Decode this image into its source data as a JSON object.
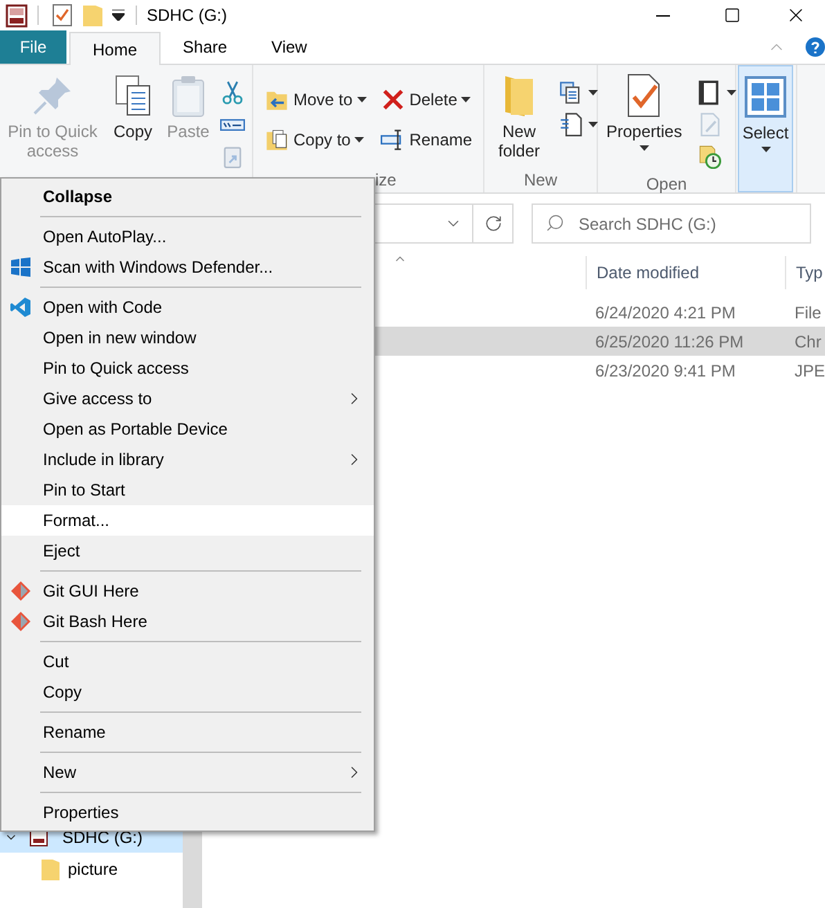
{
  "window": {
    "title": "SDHC (G:)"
  },
  "ribbon": {
    "tabs": [
      {
        "label": "File",
        "kind": "file",
        "selected": false
      },
      {
        "label": "Home",
        "kind": "tab",
        "selected": true
      },
      {
        "label": "Share",
        "kind": "tab",
        "selected": false
      },
      {
        "label": "View",
        "kind": "tab",
        "selected": false
      }
    ],
    "groups": [
      {
        "columns": [
          [
            {
              "kind": "pin",
              "label": "Pin to Quick access",
              "disabled": true,
              "dropdown": false
            }
          ],
          [
            {
              "kind": "copy",
              "label": "Copy",
              "disabled": false,
              "dropdown": false
            }
          ],
          [
            {
              "kind": "paste",
              "label": "Paste",
              "disabled": true,
              "dropdown": false
            }
          ],
          [
            {
              "kind": "cut",
              "disabled": false,
              "dropdown": false
            },
            {
              "kind": "copypath",
              "disabled": false,
              "dropdown": false
            },
            {
              "kind": "shortcut",
              "disabled": true,
              "dropdown": false
            }
          ]
        ]
      },
      {
        "label": "ize",
        "columns": [
          [
            {
              "kind": "move",
              "label": "Move to",
              "disabled": false,
              "dropdown": true
            },
            {
              "kind": "copyto",
              "label": "Copy to",
              "disabled": false,
              "dropdown": true
            }
          ],
          [
            {
              "kind": "delete",
              "label": "Delete",
              "disabled": false,
              "dropdown": true
            },
            {
              "kind": "rename",
              "label": "Rename",
              "disabled": false,
              "dropdown": false
            }
          ]
        ]
      },
      {
        "label": "New",
        "columns": [
          [
            {
              "kind": "newfolder",
              "label": "New folder",
              "disabled": false,
              "dropdown": false
            }
          ],
          [
            {
              "kind": "newitem",
              "disabled": false,
              "dropdown": true
            },
            {
              "kind": "easyaccess",
              "disabled": false,
              "dropdown": true
            }
          ]
        ]
      },
      {
        "label": "Open",
        "columns": [
          [
            {
              "kind": "properties",
              "label": "Properties",
              "disabled": false,
              "dropdown": true
            }
          ],
          [
            {
              "kind": "open",
              "disabled": false,
              "dropdown": true
            },
            {
              "kind": "edit",
              "disabled": true,
              "dropdown": false
            },
            {
              "kind": "history",
              "disabled": false,
              "dropdown": false
            }
          ]
        ]
      },
      {
        "columns": [
          [
            {
              "kind": "select",
              "label": "Select",
              "disabled": false,
              "dropdown": true
            }
          ]
        ]
      }
    ]
  },
  "search": {
    "placeholder": "Search SDHC (G:)"
  },
  "file_list": {
    "columns": [
      {
        "sorted": true
      },
      {
        "label": "Date modified",
        "sorted": false
      },
      {
        "label": "Typ",
        "sorted": false
      }
    ],
    "rows": [
      {
        "date_modified": "6/24/2020 4:21 PM",
        "type": "File",
        "selected": false
      },
      {
        "date_modified": "6/25/2020 11:26 PM",
        "type": "Chr",
        "selected": true
      },
      {
        "date_modified": "6/23/2020 9:41 PM",
        "type": "JPE",
        "selected": false
      }
    ]
  },
  "navigation_pane": {
    "items": [
      {
        "label": "SDHC (G:)",
        "selected": true,
        "expanded": true,
        "children": [
          {
            "label": "picture",
            "selected": false
          }
        ]
      }
    ]
  },
  "context_menu": {
    "items": [
      {
        "kind": "plain",
        "label": "Collapse",
        "default": true,
        "submenu": false,
        "selected": false
      },
      {
        "kind": "separator"
      },
      {
        "kind": "plain",
        "label": "Open AutoPlay...",
        "default": false,
        "submenu": false,
        "selected": false
      },
      {
        "kind": "shield",
        "label": "Scan with Windows Defender...",
        "default": false,
        "submenu": false,
        "selected": false
      },
      {
        "kind": "separator"
      },
      {
        "kind": "code",
        "label": "Open with Code",
        "default": false,
        "submenu": false,
        "selected": false
      },
      {
        "kind": "plain",
        "label": "Open in new window",
        "default": false,
        "submenu": false,
        "selected": false
      },
      {
        "kind": "plain",
        "label": "Pin to Quick access",
        "default": false,
        "submenu": false,
        "selected": false
      },
      {
        "kind": "plain",
        "label": "Give access to",
        "default": false,
        "submenu": true,
        "selected": false
      },
      {
        "kind": "plain",
        "label": "Open as Portable Device",
        "default": false,
        "submenu": false,
        "selected": false
      },
      {
        "kind": "plain",
        "label": "Include in library",
        "default": false,
        "submenu": true,
        "selected": false
      },
      {
        "kind": "plain",
        "label": "Pin to Start",
        "default": false,
        "submenu": false,
        "selected": false
      },
      {
        "kind": "plain",
        "label": "Format...",
        "default": false,
        "submenu": false,
        "selected": true
      },
      {
        "kind": "plain",
        "label": "Eject",
        "default": false,
        "submenu": false,
        "selected": false
      },
      {
        "kind": "separator"
      },
      {
        "kind": "git",
        "label": "Git GUI Here",
        "default": false,
        "submenu": false,
        "selected": false
      },
      {
        "kind": "git",
        "label": "Git Bash Here",
        "default": false,
        "submenu": false,
        "selected": false
      },
      {
        "kind": "separator"
      },
      {
        "kind": "plain",
        "label": "Cut",
        "default": false,
        "submenu": false,
        "selected": false
      },
      {
        "kind": "plain",
        "label": "Copy",
        "default": false,
        "submenu": false,
        "selected": false
      },
      {
        "kind": "separator"
      },
      {
        "kind": "plain",
        "label": "Rename",
        "default": false,
        "submenu": false,
        "selected": false
      },
      {
        "kind": "separator"
      },
      {
        "kind": "plain",
        "label": "New",
        "default": false,
        "submenu": true,
        "selected": false
      },
      {
        "kind": "separator"
      },
      {
        "kind": "plain",
        "label": "Properties",
        "default": false,
        "submenu": false,
        "selected": false
      }
    ]
  }
}
